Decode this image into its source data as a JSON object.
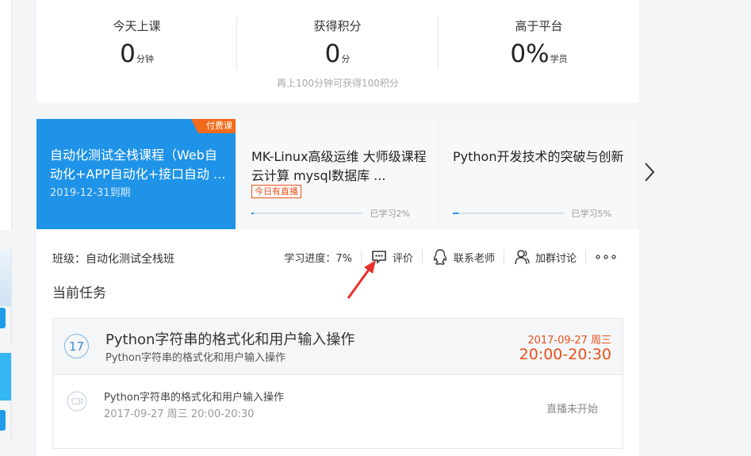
{
  "stats": {
    "items": [
      {
        "label": "今天上课",
        "value": "0",
        "unit": "分钟"
      },
      {
        "label": "获得积分",
        "value": "0",
        "unit": "分"
      },
      {
        "label": "高于平台",
        "value": "0%",
        "unit": "学员"
      }
    ],
    "hint": "再上100分钟可获得100积分"
  },
  "courses": [
    {
      "title": "自动化测试全栈课程（Web自动化+APP自动化+接口自动 ...",
      "badge": "付费课",
      "date": "2019-12-31到期",
      "active": true
    },
    {
      "title": "MK-Linux高级运维 大师级课程 云计算 mysql数据库 ...",
      "live_badge": "今日有直播",
      "progress": 0.02,
      "progress_text": "已学习2%"
    },
    {
      "title": "Python开发技术的突破与创新",
      "progress": 0.05,
      "progress_text": "已学习5%"
    }
  ],
  "main": {
    "class_label": "班级：自动化测试全栈班",
    "progress_label": "学习进度：7%",
    "toolbar": {
      "review": "评价",
      "contact_teacher": "联系老师",
      "join_group": "加群讨论"
    },
    "section_title": "当前任务",
    "task": {
      "day": "17",
      "title": "Python字符串的格式化和用户输入操作",
      "subtitle": "Python字符串的格式化和用户输入操作",
      "date": "2017-09-27 周三",
      "time": "20:00-20:30",
      "lesson": {
        "title": "Python字符串的格式化和用户输入操作",
        "time": "2017-09-27 周三 20:00-20:30",
        "status": "直播未开始"
      }
    }
  },
  "icons": {
    "review": "comment-icon",
    "contact": "qq-penguin-icon",
    "group": "users-icon",
    "more": "more-dots-icon",
    "next": "chevron-right-icon",
    "lesson": "video-camera-icon"
  },
  "colors": {
    "accent": "#1e93e7",
    "orange": "#e8501c",
    "badge": "#f26a1b"
  }
}
